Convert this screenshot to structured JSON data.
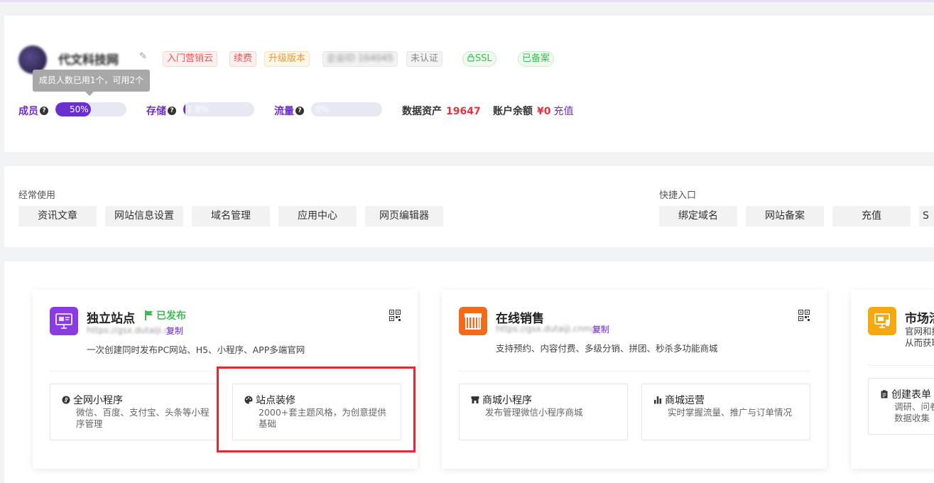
{
  "header": {
    "company_name": "代文科技网",
    "tags": [
      "入门营销云",
      "续费",
      "升级版本",
      "企业ID 164045",
      "未认证",
      "SSL",
      "已备案"
    ],
    "tooltip": "成员人数已用1个，可用2个",
    "stats": [
      {
        "label": "成员",
        "percent_text": "50%",
        "percent": 50
      },
      {
        "label": "存储",
        "percent_text": "2.8%",
        "percent": 2.8
      },
      {
        "label": "流量",
        "percent_text": "0%",
        "percent": 0
      }
    ],
    "data_assets_label": "数据资产",
    "data_assets_value": "19647",
    "balance_label": "账户余额",
    "balance_value": "¥0",
    "recharge_label": "充值"
  },
  "frequent": {
    "title": "经常使用",
    "items": [
      "资讯文章",
      "网站信息设置",
      "域名管理",
      "应用中心",
      "网页编辑器"
    ]
  },
  "shortcuts": {
    "title": "快捷入口",
    "items": [
      "绑定域名",
      "网站备案",
      "充值",
      "S"
    ]
  },
  "cards": [
    {
      "title": "独立站点",
      "status": "已发布",
      "url": "https://gsx.dutaiji.cn",
      "copy_label": "复制",
      "desc": "一次创建同时发布PC网站、H5、小程序、APP多端官网",
      "subs": [
        {
          "title": "全网小程序",
          "desc": "微信、百度、支付宝、头条等小程序管理"
        },
        {
          "title": "站点装修",
          "desc": "2000+套主题风格，为创意提供基础"
        }
      ]
    },
    {
      "title": "在线销售",
      "url": "https://gsx.dutaiji.cnmall",
      "copy_label": "复制",
      "desc": "支持预约、内容付费、多级分销、拼团、秒杀多功能商城",
      "subs": [
        {
          "title": "商城小程序",
          "desc": "发布管理微信小程序商城"
        },
        {
          "title": "商城运营",
          "desc": "实时掌握流量、推广与订单情况"
        }
      ]
    },
    {
      "title": "市场活",
      "desc_line1": "官网和推",
      "desc_line2": "从而获取",
      "subs": [
        {
          "title": "创建表单",
          "desc_line1": "调研、问卷",
          "desc_line2": "数据收集"
        }
      ]
    }
  ],
  "colors": {
    "accent": "#6e2bd4",
    "highlight": "#e22832",
    "success": "#41b957"
  }
}
